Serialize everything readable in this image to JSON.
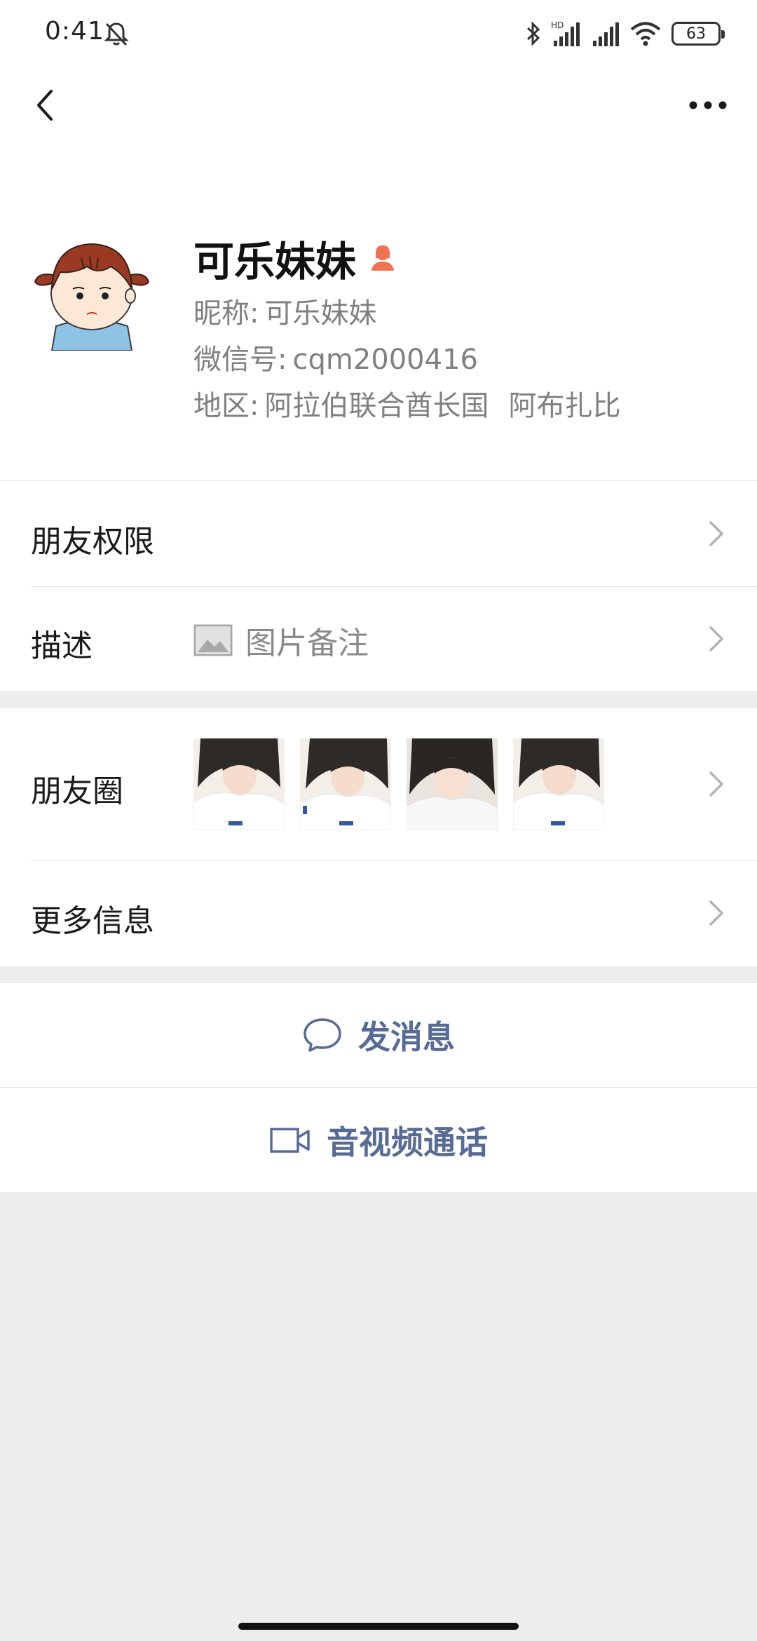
{
  "status_bar": {
    "time": "0:41",
    "battery": "63",
    "icons": [
      "mute-icon",
      "bluetooth-icon",
      "hd-signal-icon",
      "signal-icon",
      "wifi-icon",
      "battery-icon"
    ]
  },
  "nav": {
    "back_icon": "back-arrow-icon",
    "more_icon": "more-dots-icon"
  },
  "profile": {
    "name": "可乐妹妹",
    "gender": "female",
    "gender_color": "#f07353",
    "nickname_label": "昵称:",
    "nickname": "可乐妹妹",
    "wechat_id_label": "微信号:",
    "wechat_id": "cqm2000416",
    "region_label": "地区:",
    "region_country": "阿拉伯联合酋长国",
    "region_city": "阿布扎比"
  },
  "rows": {
    "permissions": "朋友权限",
    "description_label": "描述",
    "description_value": "图片备注",
    "moments": "朋友圈",
    "more_info": "更多信息"
  },
  "actions": {
    "message": "发消息",
    "video_call": "音视频通话"
  },
  "colors": {
    "link": "#576b95",
    "background": "#ededed",
    "secondary_text": "#808080"
  }
}
